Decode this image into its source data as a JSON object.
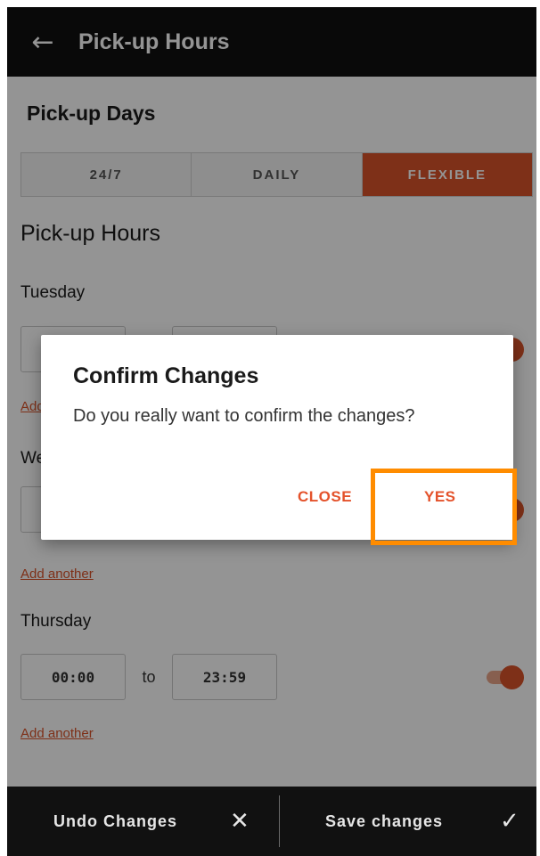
{
  "appbar": {
    "back_icon": "←",
    "title": "Pick-up Hours"
  },
  "days": {
    "title": "Pick-up Days",
    "options": [
      "24/7",
      "DAILY",
      "FLEXIBLE"
    ],
    "selected": "FLEXIBLE"
  },
  "hours": {
    "title": "Pick-up Hours",
    "to_label": "to",
    "add_another": "Add another",
    "days": [
      {
        "name": "Tuesday",
        "from": "",
        "to": "",
        "enabled": true
      },
      {
        "name": "Wednesday",
        "from": "",
        "to": "",
        "enabled": true
      },
      {
        "name": "Thursday",
        "from": "00:00",
        "to": "23:59",
        "enabled": true
      }
    ]
  },
  "dialog": {
    "title": "Confirm Changes",
    "message": "Do you really want to confirm the changes?",
    "close_label": "CLOSE",
    "yes_label": "YES"
  },
  "bottombar": {
    "undo_label": "Undo Changes",
    "undo_icon": "✕",
    "save_label": "Save changes",
    "save_icon": "✓"
  },
  "colors": {
    "accent": "#d9532a",
    "highlight": "#ff8c00",
    "bar": "#111111"
  }
}
